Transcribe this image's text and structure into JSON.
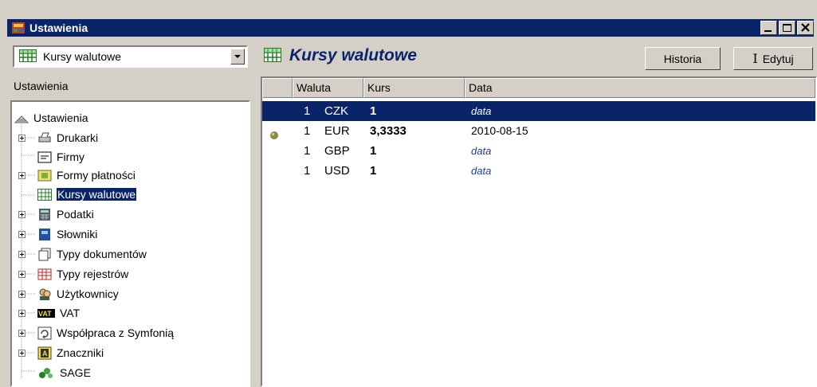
{
  "window": {
    "title": "Ustawienia"
  },
  "left_panel": {
    "combo_value": "Kursy walutowe",
    "section_label": "Ustawienia",
    "tree": [
      {
        "label": "Ustawienia",
        "icon": "network-icon"
      },
      {
        "label": "Drukarki",
        "icon": "printer-icon"
      },
      {
        "label": "Firmy",
        "icon": "company-icon"
      },
      {
        "label": "Formy płatności",
        "icon": "payment-icon"
      },
      {
        "label": "Kursy walutowe",
        "icon": "grid-icon",
        "selected": true
      },
      {
        "label": "Podatki",
        "icon": "calculator-icon"
      },
      {
        "label": "Słowniki",
        "icon": "dictionary-icon"
      },
      {
        "label": "Typy dokumentów",
        "icon": "documents-icon"
      },
      {
        "label": "Typy rejestrów",
        "icon": "register-icon"
      },
      {
        "label": "Użytkownicy",
        "icon": "users-icon"
      },
      {
        "label": "VAT",
        "icon": "vat-icon"
      },
      {
        "label": "Współpraca z Symfonią",
        "icon": "sync-icon"
      },
      {
        "label": "Znaczniki",
        "icon": "marker-icon"
      },
      {
        "label": "SAGE",
        "icon": "sage-icon"
      }
    ]
  },
  "right_panel": {
    "title": "Kursy walutowe",
    "history_button": "Historia",
    "edit_button": "Edytuj",
    "columns": [
      "Waluta",
      "Kurs",
      "Data"
    ],
    "rows": [
      {
        "qty": "1",
        "currency": "CZK",
        "rate": "1",
        "date": "data",
        "selected": true
      },
      {
        "qty": "1",
        "currency": "EUR",
        "rate": "3,3333",
        "date": "2010-08-15",
        "marker": true
      },
      {
        "qty": "1",
        "currency": "GBP",
        "rate": "1",
        "date": "data"
      },
      {
        "qty": "1",
        "currency": "USD",
        "rate": "1",
        "date": "data"
      }
    ]
  },
  "colors": {
    "selection": "#0a246a",
    "face": "#d4d0c8"
  }
}
